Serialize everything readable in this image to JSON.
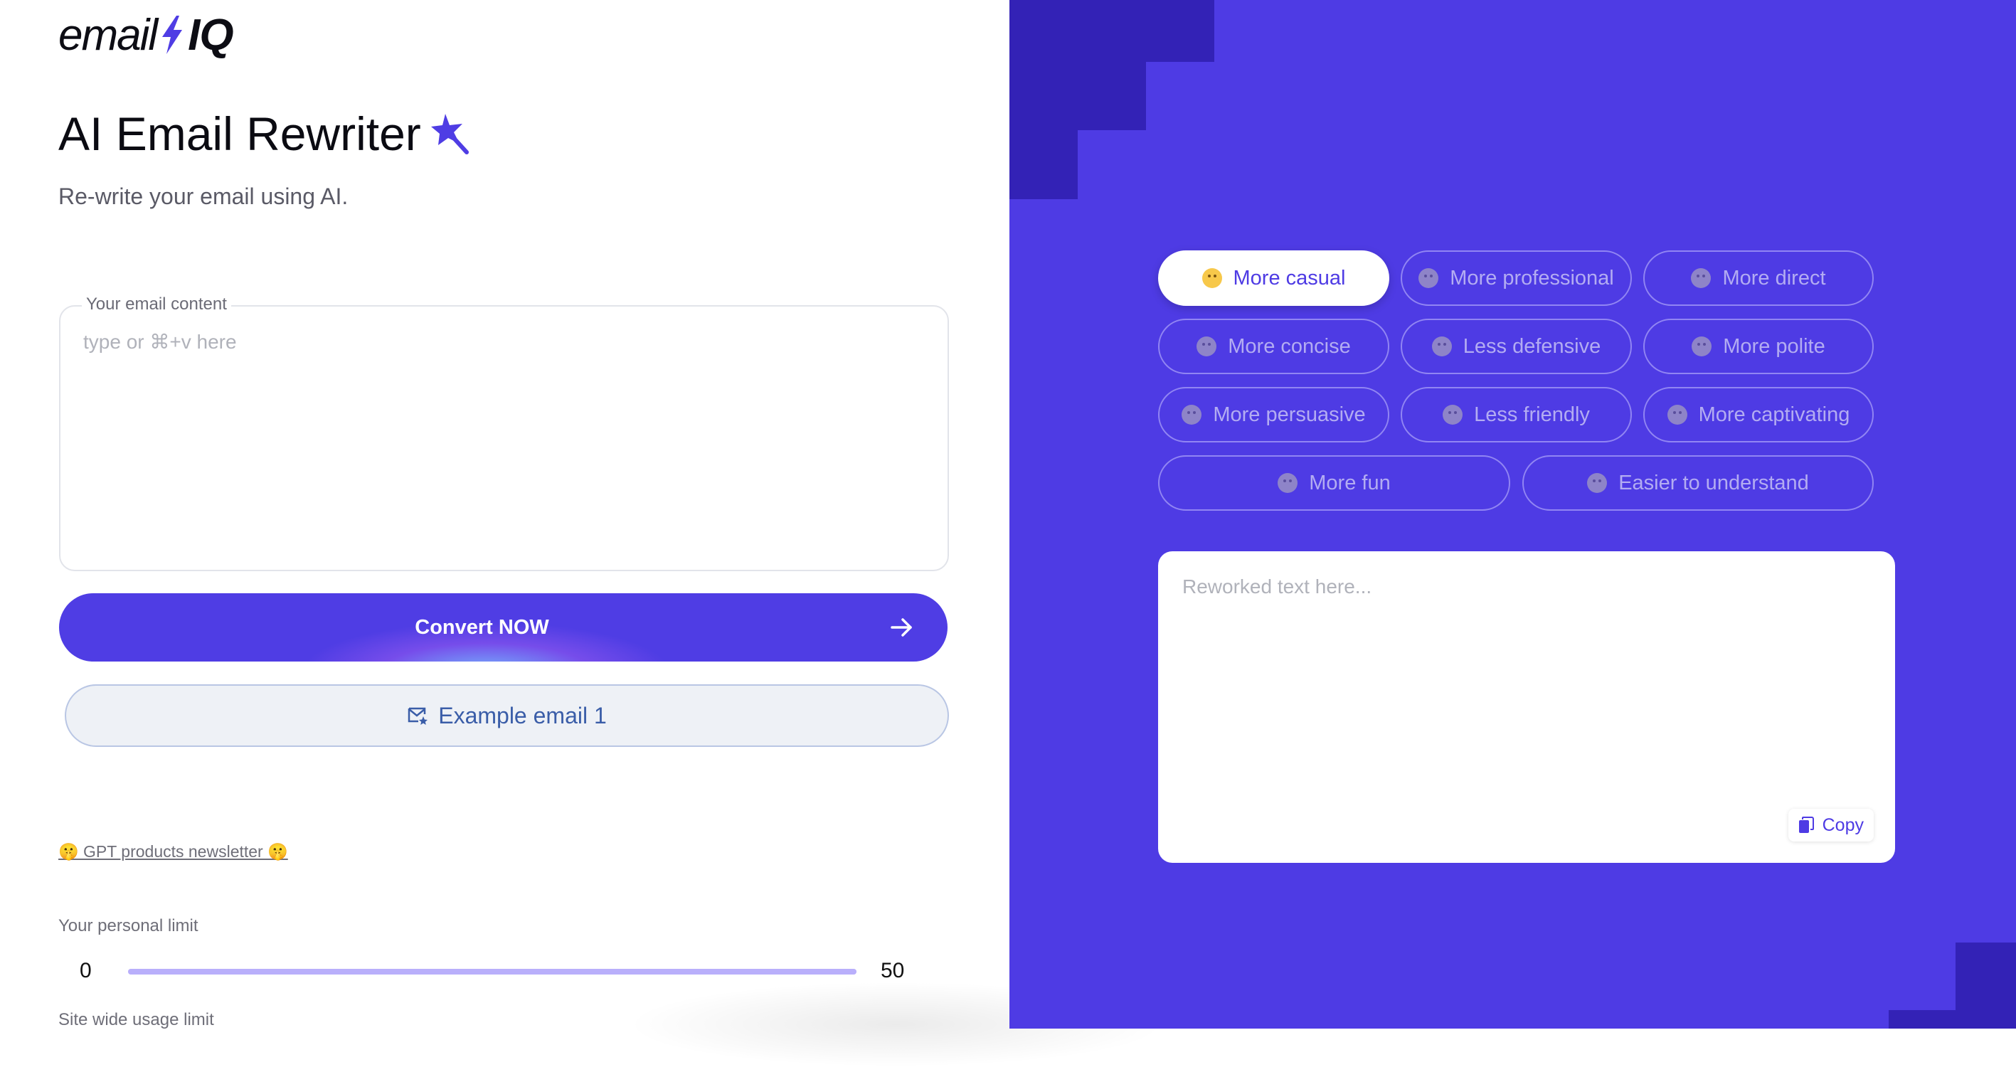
{
  "brand": {
    "logo_text": "email",
    "logo_suffix": "IQ"
  },
  "header": {
    "title": "AI Email Rewriter",
    "subtitle": "Re-write your email using AI."
  },
  "email_input": {
    "label": "Your email content",
    "placeholder": "type or ⌘+v here",
    "value": ""
  },
  "actions": {
    "convert_label": "Convert NOW",
    "example_label": "Example email 1"
  },
  "newsletter": {
    "link_text": "🤫 GPT products newsletter 🤫"
  },
  "limits": {
    "personal_label": "Your personal limit",
    "min": "0",
    "max": "50",
    "used": 50,
    "site_label": "Site wide usage limit"
  },
  "tones": [
    {
      "label": "More casual",
      "icon": "angel-face-icon",
      "active": true
    },
    {
      "label": "More professional",
      "icon": "briefcase-icon",
      "active": false
    },
    {
      "label": "More direct",
      "icon": "neutral-face-icon",
      "active": false
    },
    {
      "label": "More concise",
      "icon": "nerd-face-icon",
      "active": false
    },
    {
      "label": "Less defensive",
      "icon": "relieved-face-icon",
      "active": false
    },
    {
      "label": "More polite",
      "icon": "smiling-face-icon",
      "active": false
    },
    {
      "label": "More persuasive",
      "icon": "sunglasses-face-icon",
      "active": false
    },
    {
      "label": "Less friendly",
      "icon": "unamused-face-icon",
      "active": false
    },
    {
      "label": "More captivating",
      "icon": "star-struck-face-icon",
      "active": false
    },
    {
      "label": "More fun",
      "icon": "winking-face-icon",
      "active": false
    },
    {
      "label": "Easier to understand",
      "icon": "grinning-face-icon",
      "active": false
    }
  ],
  "output": {
    "placeholder": "Reworked text here...",
    "value": "",
    "copy_label": "Copy"
  },
  "colors": {
    "accent": "#4f3de4",
    "panel": "#4e3be4",
    "panel_dark": "#3322b6",
    "example_text": "#3a5da8"
  }
}
